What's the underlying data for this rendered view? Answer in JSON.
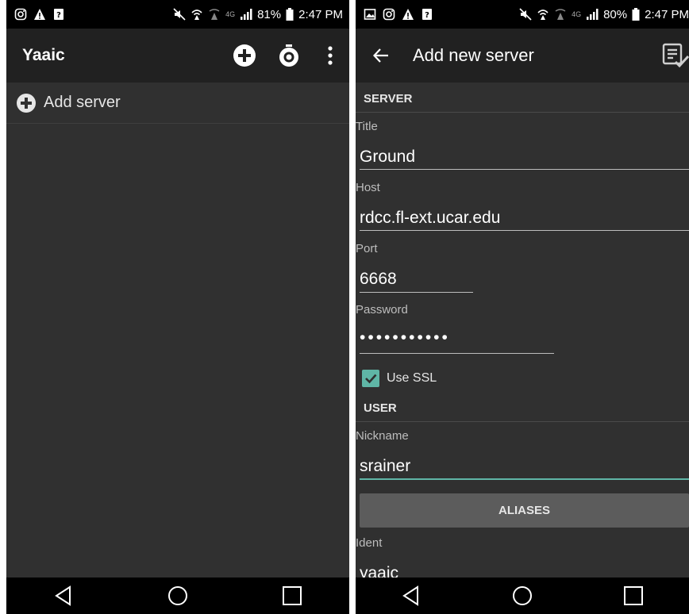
{
  "left": {
    "status": {
      "battery": "81%",
      "time": "2:47 PM",
      "network": "4G"
    },
    "app_title": "Yaaic",
    "list": {
      "add_server_label": "Add server"
    }
  },
  "right": {
    "status": {
      "battery": "80%",
      "time": "2:47 PM",
      "network": "4G"
    },
    "title": "Add new server",
    "sections": {
      "server": "SERVER",
      "user": "USER"
    },
    "fields": {
      "title": {
        "label": "Title",
        "value": "Ground"
      },
      "host": {
        "label": "Host",
        "value": "rdcc.fl-ext.ucar.edu"
      },
      "port": {
        "label": "Port",
        "value": "6668"
      },
      "password": {
        "label": "Password",
        "value": "•••••••••••"
      },
      "nickname": {
        "label": "Nickname",
        "value": "srainer"
      },
      "ident": {
        "label": "Ident",
        "value": "yaaic"
      }
    },
    "use_ssl": {
      "label": "Use SSL",
      "checked": true
    },
    "aliases_button": "ALIASES"
  },
  "colors": {
    "accent": "#5fb6a6",
    "appbar": "#212121",
    "background": "#303030"
  }
}
